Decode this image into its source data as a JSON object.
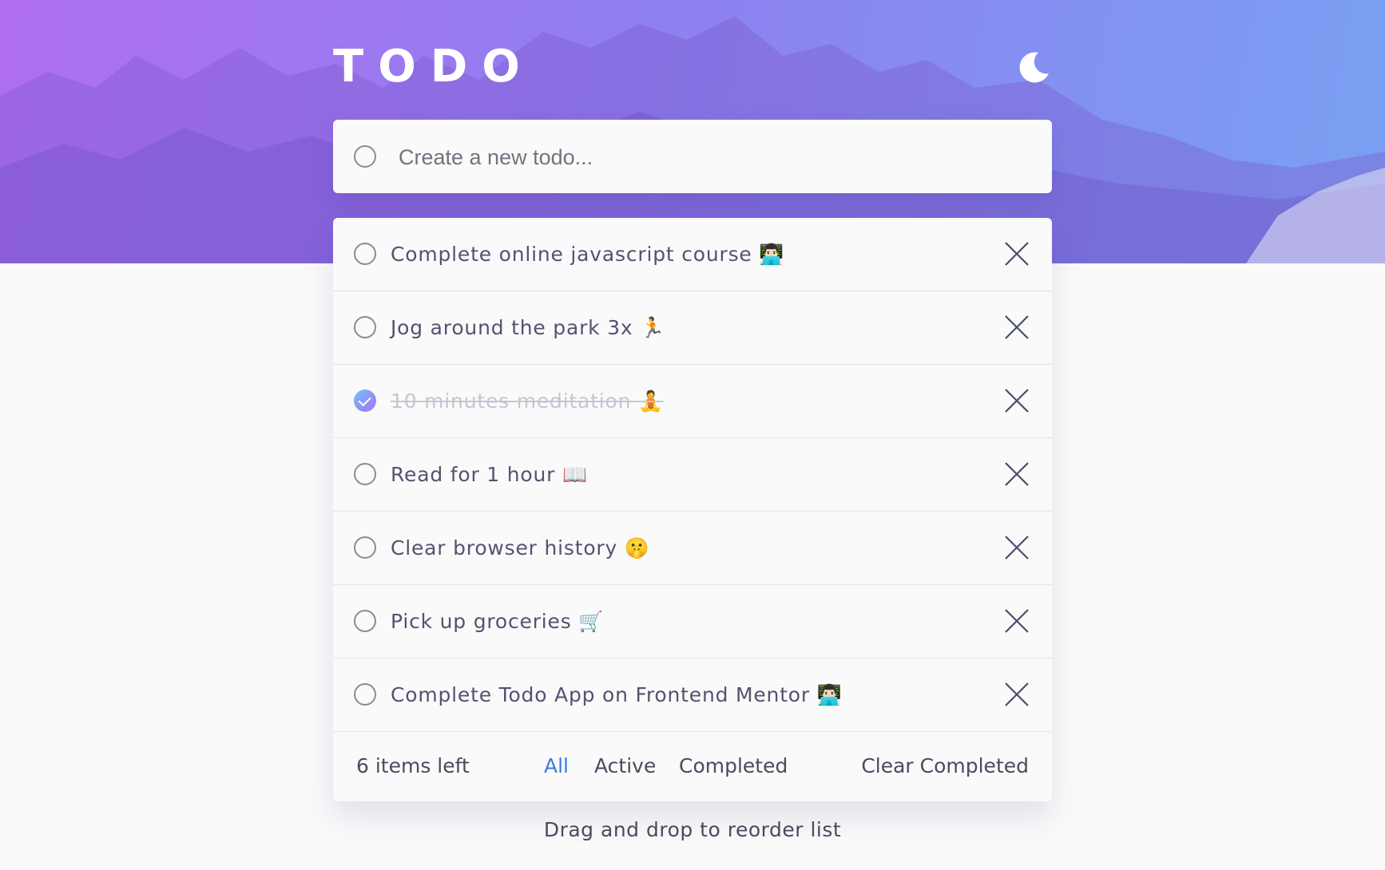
{
  "header": {
    "title": "TODO",
    "theme_icon": "moon-icon"
  },
  "new_todo": {
    "placeholder": "Create a new todo...",
    "value": ""
  },
  "todos": [
    {
      "text": "Complete online javascript course 👨🏻‍💻",
      "completed": false
    },
    {
      "text": "Jog around the park 3x 🏃",
      "completed": false
    },
    {
      "text": "10 minutes meditation 🧘",
      "completed": true
    },
    {
      "text": "Read for 1 hour 📖",
      "completed": false
    },
    {
      "text": "Clear browser history 🤫",
      "completed": false
    },
    {
      "text": "Pick up groceries 🛒",
      "completed": false
    },
    {
      "text": "Complete Todo App on Frontend Mentor 👨🏻‍💻",
      "completed": false
    }
  ],
  "footer": {
    "items_left": "6 items left",
    "filters": [
      "All",
      "Active",
      "Completed"
    ],
    "active_filter": "All",
    "clear_label": "Clear Completed"
  },
  "hint": "Drag and drop to reorder list",
  "colors": {
    "accent": "#3a7ce0",
    "gradient_start": "#b06ef2",
    "gradient_end": "#79a0f2",
    "check_gradient_start": "#6fc2f8",
    "check_gradient_end": "#a972f0"
  }
}
